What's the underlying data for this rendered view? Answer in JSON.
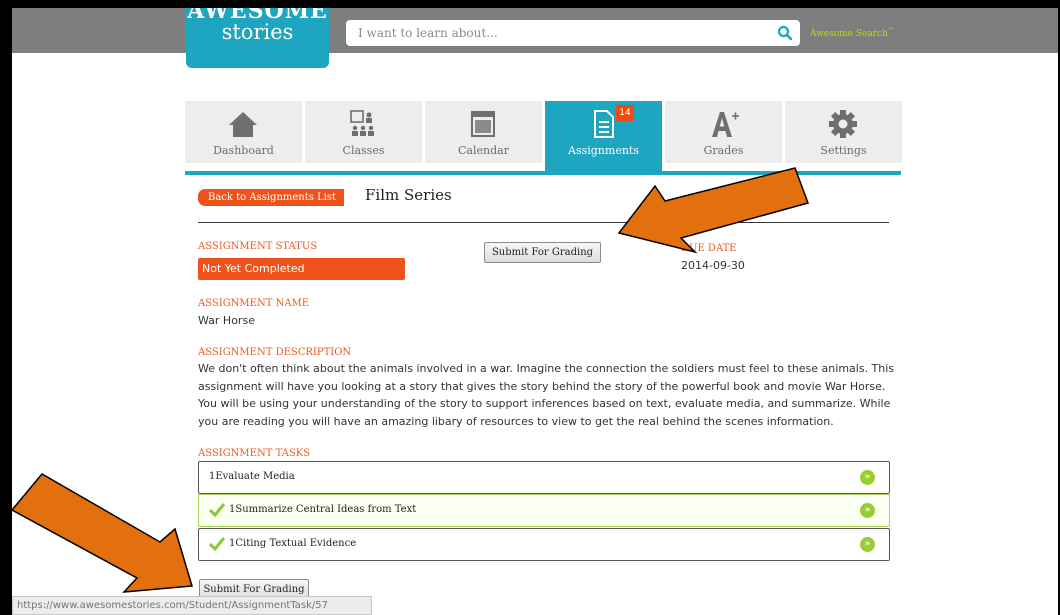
{
  "logo": {
    "line1": "AWESOME",
    "line2": "stories"
  },
  "search": {
    "placeholder": "I want to learn about...",
    "label": "Awesome Search",
    "tm": "™"
  },
  "tabs": [
    {
      "label": "Dashboard",
      "icon": "home-icon"
    },
    {
      "label": "Classes",
      "icon": "classes-icon"
    },
    {
      "label": "Calendar",
      "icon": "calendar-icon"
    },
    {
      "label": "Assignments",
      "icon": "document-icon",
      "badge": "14",
      "active": true
    },
    {
      "label": "Grades",
      "icon": "grade-a-plus-icon"
    },
    {
      "label": "Settings",
      "icon": "gear-icon"
    }
  ],
  "header": {
    "back_label": "Back to Assignments List",
    "title": "Film Series"
  },
  "assignment": {
    "status_label": "ASSIGNMENT STATUS",
    "status_value": "Not Yet Completed",
    "submit_label": "Submit For Grading",
    "due_label": "DUE DATE",
    "due_value": "2014-09-30",
    "name_label": "ASSIGNMENT NAME",
    "name_value": "War Horse",
    "description_label": "ASSIGNMENT DESCRIPTION",
    "description": "We don't often think about the animals involved in a war. Imagine the connection the soldiers must feel to these animals. This assignment will have you looking at a story that gives the story behind the story of the powerful book and movie War Horse. You will be using your understanding of the story to support inferences based on text, evaluate media, and summarize. While you are reading you will have an amazing libary of resources to view to get the real behind the scenes information.",
    "tasks_label": "ASSIGNMENT TASKS"
  },
  "tasks": [
    {
      "name": "1Evaluate Media",
      "completed": false
    },
    {
      "name": "1Summarize Central Ideas from Text",
      "completed": true
    },
    {
      "name": "1Citing Textual Evidence",
      "completed": true
    }
  ],
  "bottom_submit_label": "Submit For Grading",
  "status_url": "https://www.awesomestories.com/Student/AssignmentTask/57",
  "colors": {
    "brand": "#1ea5bf",
    "accent": "#f05319",
    "success": "#9acd2f",
    "annotation_arrow": "#e0700f"
  }
}
